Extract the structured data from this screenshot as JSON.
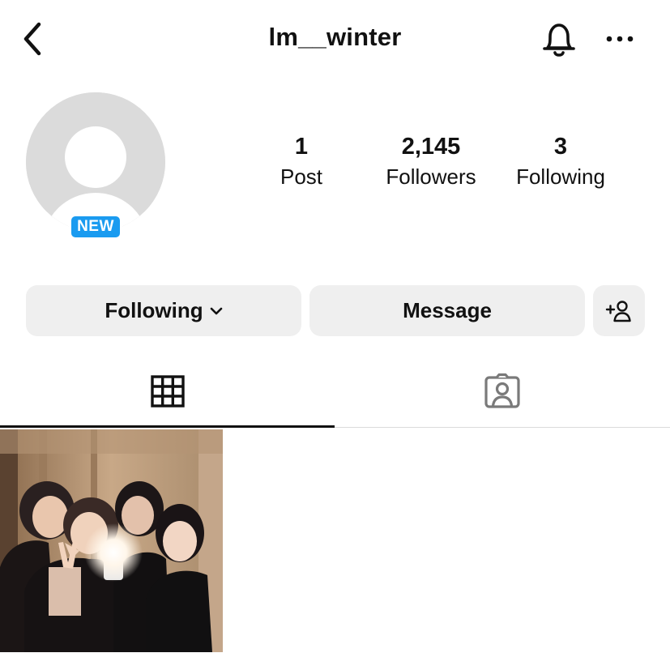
{
  "header": {
    "back_icon": "chevron-left-icon",
    "username": "lm__winter",
    "notification_icon": "bell-icon",
    "more_icon": "more-horizontal-icon"
  },
  "profile": {
    "avatar_icon": "default-avatar-icon",
    "badge": "NEW"
  },
  "stats": [
    {
      "value": "1",
      "label": "Post"
    },
    {
      "value": "2,145",
      "label": "Followers"
    },
    {
      "value": "3",
      "label": "Following"
    }
  ],
  "actions": {
    "following_label": "Following",
    "message_label": "Message",
    "add_user_icon": "add-person-icon"
  },
  "tabs": [
    {
      "icon": "grid-icon",
      "active": true
    },
    {
      "icon": "tagged-icon",
      "active": false
    }
  ],
  "posts": [
    {
      "type": "photo"
    }
  ],
  "colors": {
    "badge": "#1a9bf0",
    "button_bg": "#efefef",
    "avatar_bg": "#dbdbdb",
    "text": "#111111"
  }
}
